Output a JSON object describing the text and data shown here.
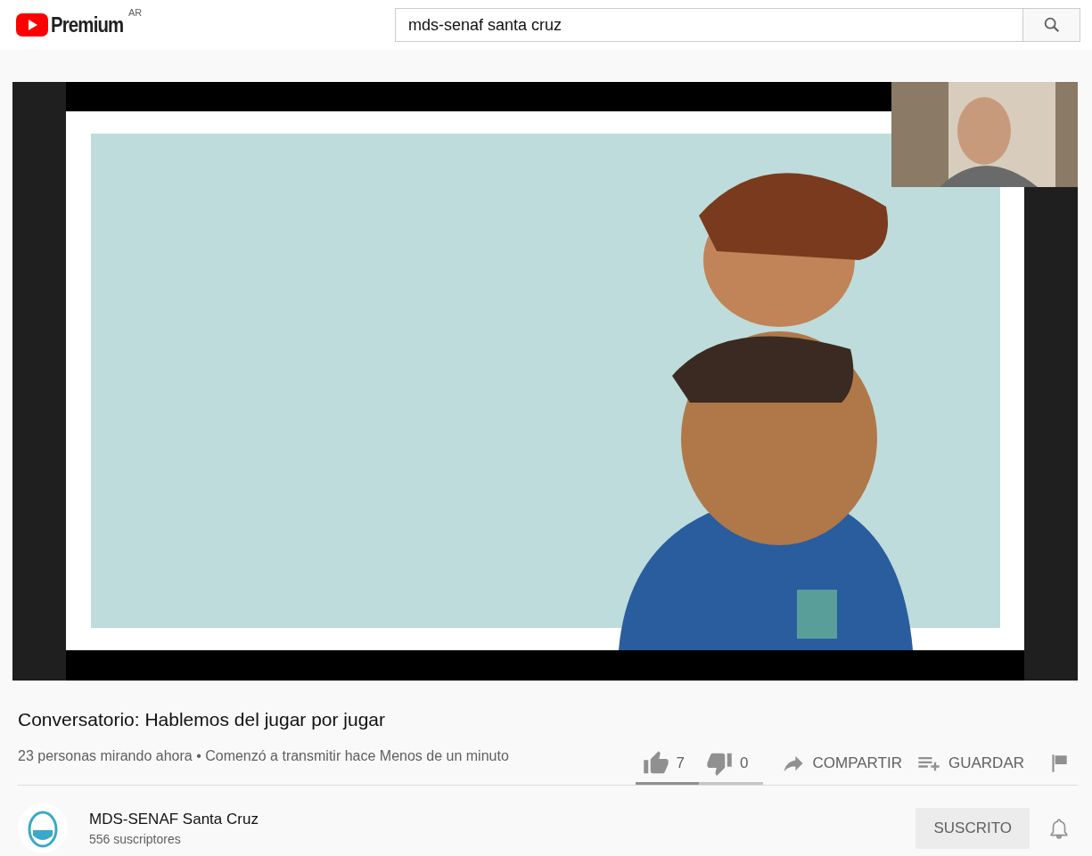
{
  "header": {
    "logo": "Premium",
    "region": "AR",
    "search": {
      "value": "mds-senaf santa cruz"
    }
  },
  "title": "Conversatorio: Hablemos del jugar por jugar",
  "info": "23 personas mirando ahora • Comenzó a transmitir hace Menos de un minuto",
  "actions": {
    "likes": "7",
    "dislikes": "0",
    "sentiment": {
      "level": 0.5
    },
    "share": "COMPARTIR",
    "save": "GUARDAR"
  },
  "channel": {
    "name": "MDS-SENAF Santa Cruz",
    "subscribers": "556 suscriptores",
    "subscribe_button": "SUSCRITO"
  }
}
